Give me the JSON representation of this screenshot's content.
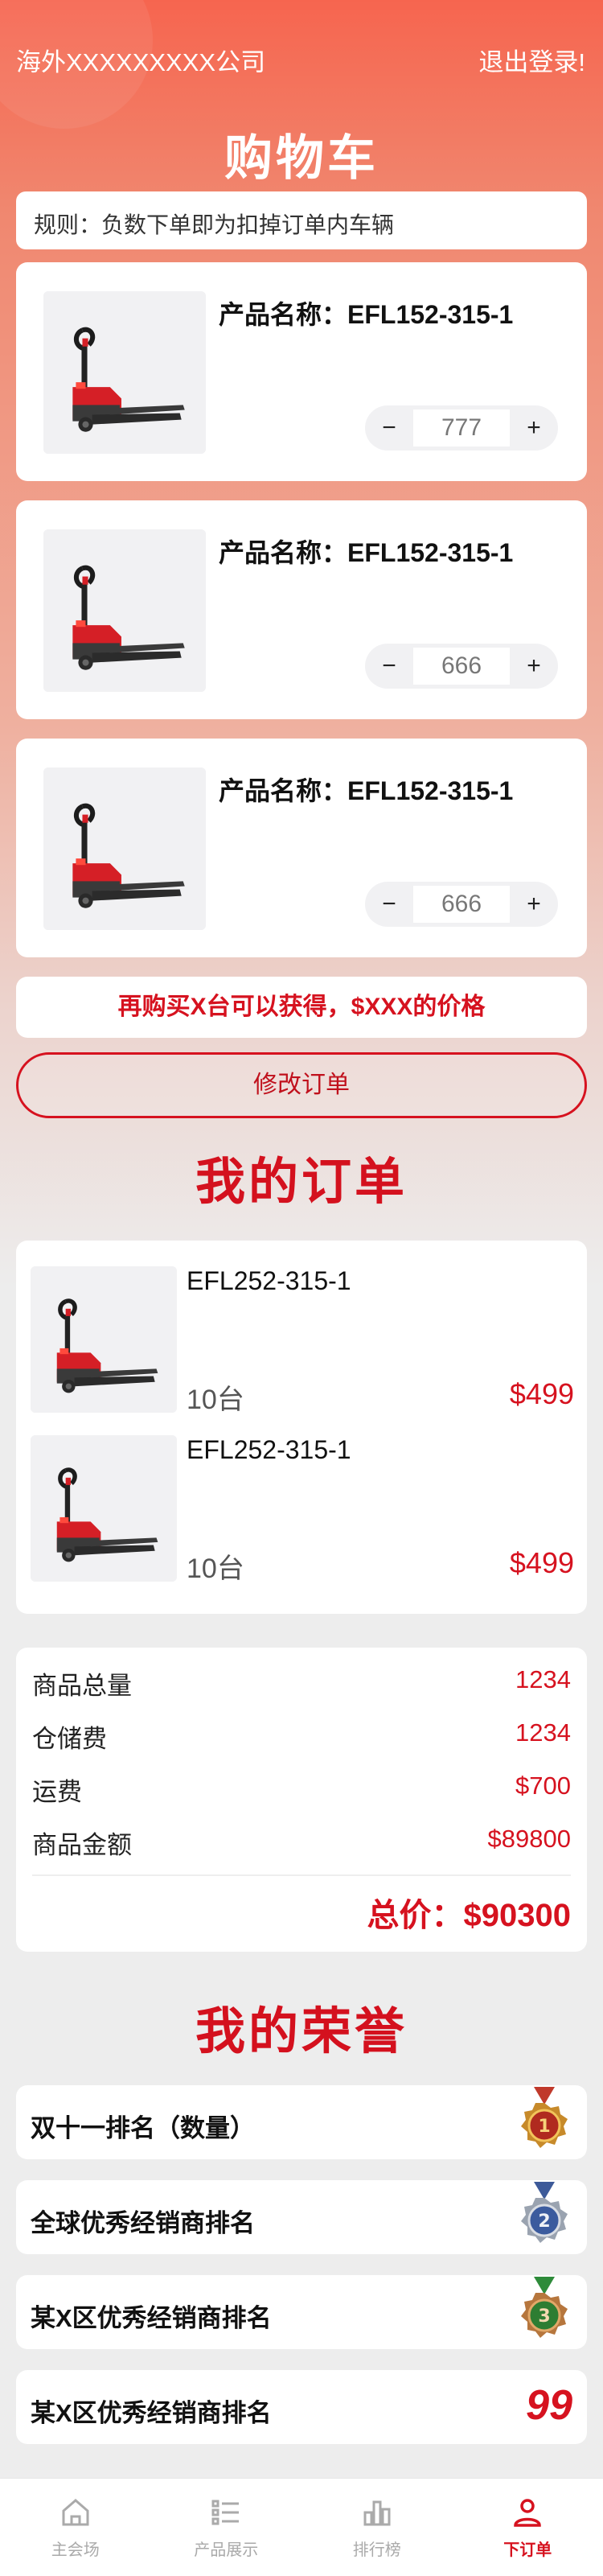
{
  "header": {
    "company": "海外XXXXXXXXX公司",
    "logout": "退出登录!",
    "title": "购物车"
  },
  "rules": "规则：负数下单即为扣掉订单内车辆",
  "cart": {
    "items": [
      {
        "name": "产品名称：EFL152-315-1",
        "qty": "777",
        "minus": "−",
        "plus": "+"
      },
      {
        "name": "产品名称：EFL152-315-1",
        "qty": "666",
        "minus": "−",
        "plus": "+"
      },
      {
        "name": "产品名称：EFL152-315-1",
        "qty": "666",
        "minus": "−",
        "plus": "+"
      }
    ],
    "promo": "再购买X台可以获得，$XXX的价格",
    "edit_button": "修改订单"
  },
  "orders": {
    "title": "我的订单",
    "items": [
      {
        "name": "EFL252-315-1",
        "qty": "10台",
        "price": "$499"
      },
      {
        "name": "EFL252-315-1",
        "qty": "10台",
        "price": "$499"
      }
    ]
  },
  "summary": {
    "rows": [
      {
        "label": "商品总量",
        "value": "1234"
      },
      {
        "label": "仓储费",
        "value": "1234"
      },
      {
        "label": "运费",
        "value": "$700"
      },
      {
        "label": "商品金额",
        "value": "$89800"
      }
    ],
    "total": "总价：$90300"
  },
  "honors": {
    "title": "我的荣誉",
    "items": [
      {
        "label": "双十一排名（数量）",
        "rank": "1",
        "medal_color": "#c0392b"
      },
      {
        "label": "全球优秀经销商排名",
        "rank": "2",
        "medal_color": "#3d5a99"
      },
      {
        "label": "某X区优秀经销商排名",
        "rank": "3",
        "medal_color": "#2e8b3a"
      },
      {
        "label": "某X区优秀经销商排名",
        "rank": "99"
      }
    ]
  },
  "tabbar": {
    "tabs": [
      {
        "label": "主会场",
        "icon": "home-icon"
      },
      {
        "label": "产品展示",
        "icon": "list-icon"
      },
      {
        "label": "排行榜",
        "icon": "bar-chart-icon"
      },
      {
        "label": "下订单",
        "icon": "user-icon"
      }
    ],
    "active_index": 3
  },
  "colors": {
    "accent": "#d6121f",
    "header_gradient_top": "#f6654f",
    "background": "#ededed"
  }
}
